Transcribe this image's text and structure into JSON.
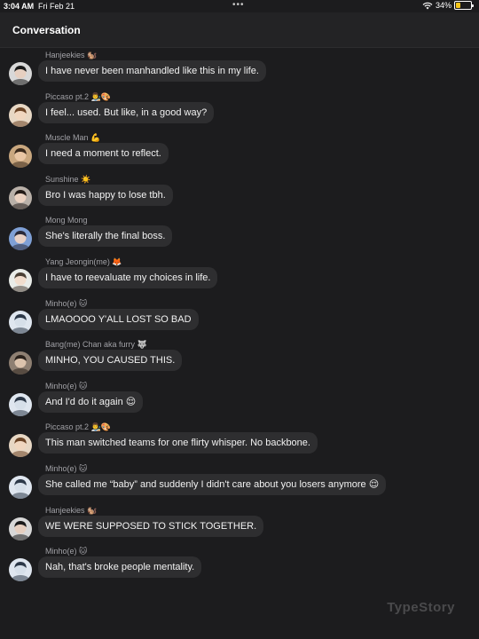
{
  "status_bar": {
    "time": "3:04 AM",
    "date": "Fri Feb 21",
    "dots": "•••",
    "battery_percent": "34%",
    "battery_level": 0.34,
    "battery_color": "#f5c518",
    "icons": [
      "wifi-icon",
      "battery-charging-icon"
    ]
  },
  "header": {
    "title": "Conversation"
  },
  "messages": [
    {
      "sender": "Hanjeekies",
      "sender_emoji": "🐿️",
      "text": "I have never been manhandled like this in my life.",
      "text_emoji": "",
      "avatar": "avatar-dark-hair"
    },
    {
      "sender": "Piccaso pt.2",
      "sender_emoji": "👨‍🎨🎨",
      "text": "I feel... used. But like, in a good way?",
      "text_emoji": "",
      "avatar": "avatar-brown-hair"
    },
    {
      "sender": "Muscle Man",
      "sender_emoji": "💪",
      "text": "I need a moment to reflect.",
      "text_emoji": "",
      "avatar": "avatar-smiling"
    },
    {
      "sender": "Sunshine",
      "sender_emoji": "☀️",
      "text": "Bro I was happy to lose tbh.",
      "text_emoji": "",
      "avatar": "avatar-dark-long-hair"
    },
    {
      "sender": "Mong Mong",
      "sender_emoji": "",
      "text": "She's literally the final boss.",
      "text_emoji": "",
      "avatar": "avatar-blue-tint"
    },
    {
      "sender": "Yang Jeongin(me)",
      "sender_emoji": "🦊",
      "text": "I have to reevaluate my choices in life.",
      "text_emoji": "",
      "avatar": "avatar-light"
    },
    {
      "sender": "Minho(e)",
      "sender_emoji": "🐱",
      "text": "LMAOOOO Y'ALL LOST SO BAD",
      "text_emoji": "",
      "avatar": "avatar-minho"
    },
    {
      "sender": "Bang(me) Chan aka furry",
      "sender_emoji": "🐺",
      "text": "MINHO, YOU CAUSED THIS.",
      "text_emoji": "",
      "avatar": "avatar-chan"
    },
    {
      "sender": "Minho(e)",
      "sender_emoji": "🐱",
      "text": "And I'd do it again",
      "text_emoji": "😌",
      "avatar": "avatar-minho"
    },
    {
      "sender": "Piccaso pt.2",
      "sender_emoji": "👨‍🎨🎨",
      "text": "This man switched teams for one flirty whisper. No backbone.",
      "text_emoji": "",
      "avatar": "avatar-brown-hair"
    },
    {
      "sender": "Minho(e)",
      "sender_emoji": "🐱",
      "text": "She called me “baby” and suddenly I didn't care about you losers anymore",
      "text_emoji": "😌",
      "avatar": "avatar-minho"
    },
    {
      "sender": "Hanjeekies",
      "sender_emoji": "🐿️",
      "text": "WE WERE SUPPOSED TO STICK TOGETHER.",
      "text_emoji": "",
      "avatar": "avatar-dark-hair"
    },
    {
      "sender": "Minho(e)",
      "sender_emoji": "🐱",
      "text": "Nah, that's broke people mentality.",
      "text_emoji": "",
      "avatar": "avatar-minho"
    }
  ],
  "watermark": "TypeStory",
  "colors": {
    "background": "#1c1c1e",
    "header": "#232325",
    "bubble": "#2e2e30",
    "sender_text": "#a1a1a6",
    "message_text": "#f2f2f2"
  }
}
